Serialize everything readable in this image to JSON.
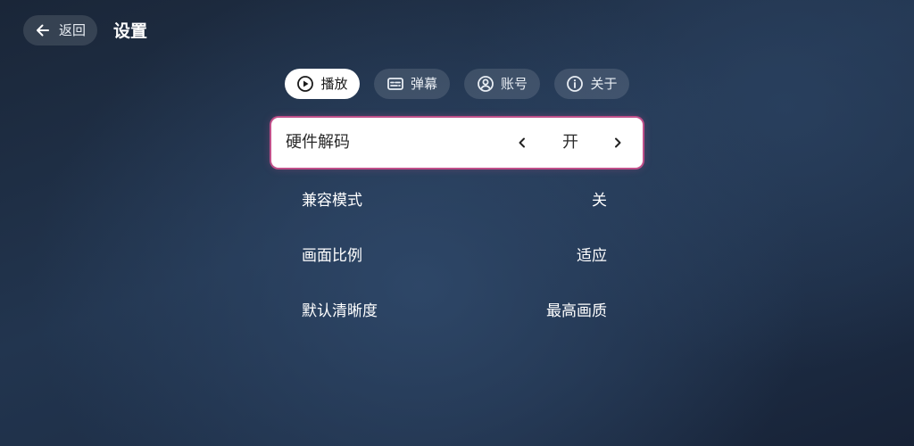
{
  "header": {
    "back_label": "返回",
    "title": "设置"
  },
  "tabs": [
    {
      "label": "播放",
      "icon": "play-circle-icon",
      "active": true
    },
    {
      "label": "弹幕",
      "icon": "danmaku-icon",
      "active": false
    },
    {
      "label": "账号",
      "icon": "account-icon",
      "active": false
    },
    {
      "label": "关于",
      "icon": "info-icon",
      "active": false
    }
  ],
  "settings": [
    {
      "label": "硬件解码",
      "value": "开",
      "focused": true
    },
    {
      "label": "兼容模式",
      "value": "关",
      "focused": false
    },
    {
      "label": "画面比例",
      "value": "适应",
      "focused": false
    },
    {
      "label": "默认清晰度",
      "value": "最高画质",
      "focused": false
    }
  ],
  "colors": {
    "background": "#1d2d45",
    "active_tab": "#ffffff",
    "focus_border": "#c0508a",
    "chip_background": "rgba(255,255,255,0.12)"
  }
}
